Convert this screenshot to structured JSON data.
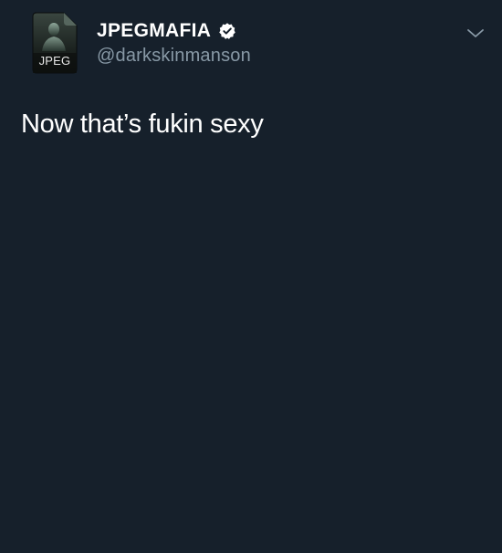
{
  "tweet": {
    "avatar": {
      "label": "JPEG",
      "icon": "jpeg-file-icon"
    },
    "author": {
      "display_name": "JPEGMAFIA",
      "handle": "@darkskinmanson",
      "verified": true,
      "verified_icon": "verified-badge-icon"
    },
    "menu_icon": "chevron-down-icon",
    "text": "Now that’s fukin sexy"
  },
  "colors": {
    "background": "#16202b",
    "name": "#ffffff",
    "handle": "#8899a6",
    "text": "#ffffff",
    "chevron": "#8899a6"
  }
}
